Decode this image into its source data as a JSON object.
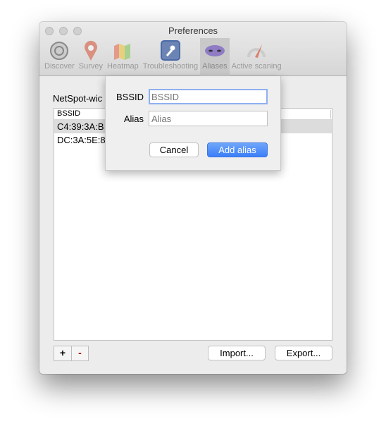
{
  "window": {
    "title": "Preferences"
  },
  "tabs": [
    {
      "label": "Discover",
      "icon": "discover-icon"
    },
    {
      "label": "Survey",
      "icon": "map-pin-icon"
    },
    {
      "label": "Heatmap",
      "icon": "map-icon"
    },
    {
      "label": "Troubleshooting",
      "icon": "wrench-icon"
    },
    {
      "label": "Aliases",
      "icon": "mask-icon",
      "active": true
    },
    {
      "label": "Active scaning",
      "icon": "gauge-icon"
    }
  ],
  "content": {
    "label": "NetSpot-wic",
    "column": "BSSID",
    "rows": [
      "C4:39:3A:B",
      "DC:3A:5E:8"
    ],
    "import": "Import...",
    "export": "Export...",
    "add": "+",
    "remove": "-"
  },
  "dialog": {
    "bssid_label": "BSSID",
    "bssid_placeholder": "BSSID",
    "alias_label": "Alias",
    "alias_placeholder": "Alias",
    "cancel": "Cancel",
    "add": "Add alias"
  },
  "colors": {
    "accent": "#3b7ef7"
  }
}
